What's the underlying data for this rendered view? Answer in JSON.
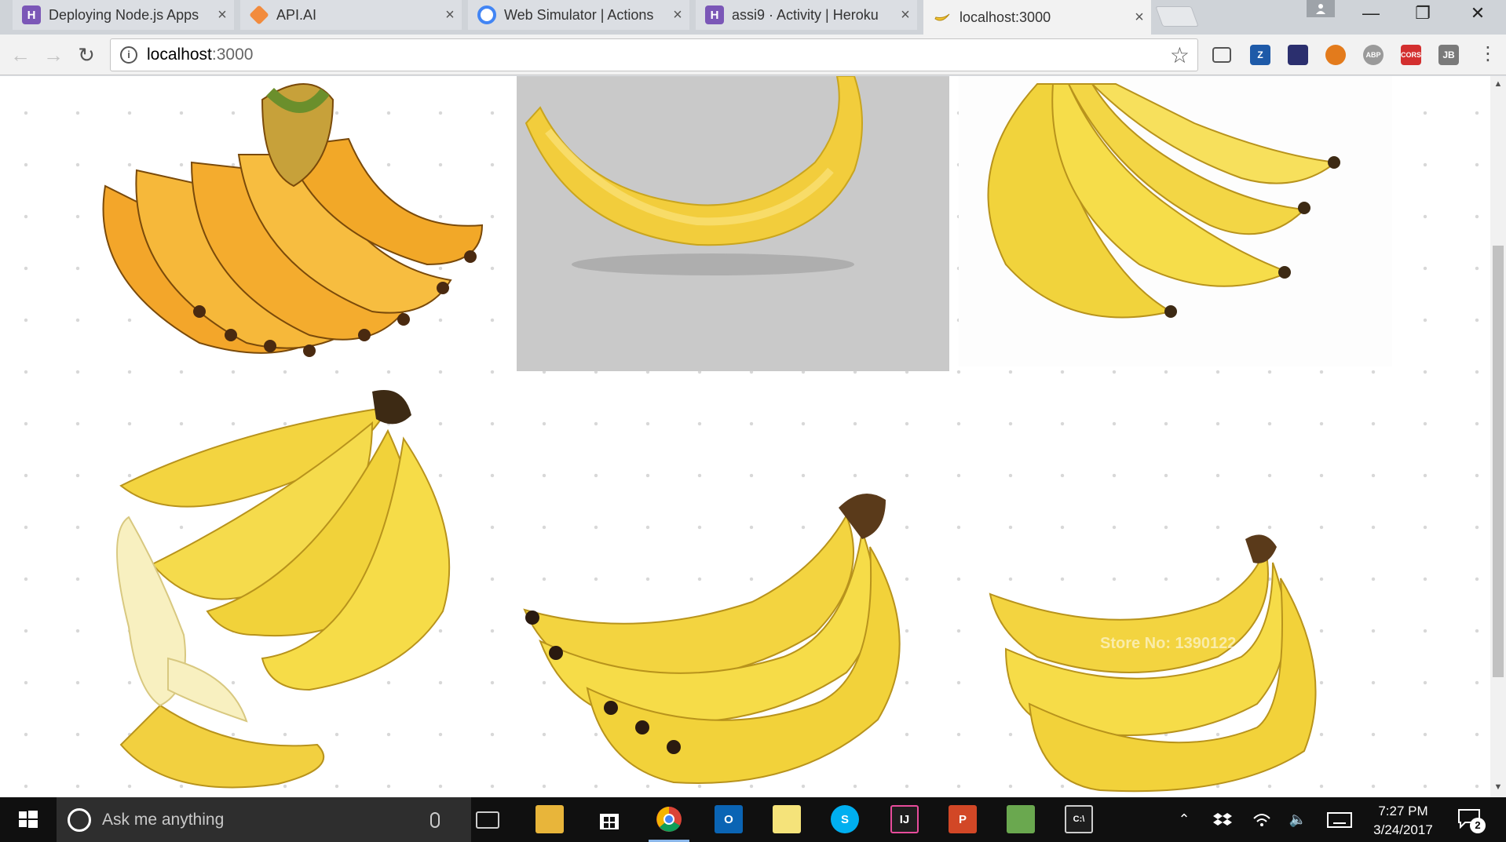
{
  "browser": {
    "tabs": [
      {
        "title": "Deploying Node.js Apps",
        "favicon_letter": "H",
        "favicon_color": "#7b57b7",
        "active": false
      },
      {
        "title": "API.AI",
        "favicon_letter": "",
        "favicon_color": "#f28b3d",
        "active": false
      },
      {
        "title": "Web Simulator | Actions",
        "favicon_letter": "",
        "favicon_color": "#4285f4",
        "active": false
      },
      {
        "title": "assi9 · Activity | Heroku",
        "favicon_letter": "H",
        "favicon_color": "#7b57b7",
        "active": false
      },
      {
        "title": "localhost:3000",
        "favicon_letter": "",
        "favicon_color": "#f2c230",
        "active": true
      }
    ],
    "close_glyph": "×",
    "window_controls": {
      "minimize": "—",
      "restore": "❐",
      "close": "✕"
    },
    "address": {
      "host": "localhost",
      "port": ":3000"
    },
    "extensions": [
      {
        "name": "cast-icon",
        "label": "",
        "color": "#f2f2f2"
      },
      {
        "name": "zotero-icon",
        "label": "Z",
        "color": "#1e5aa8"
      },
      {
        "name": "ext-dark-icon",
        "label": "",
        "color": "#2b2f6e"
      },
      {
        "name": "ext-globe-icon",
        "label": "",
        "color": "#e37b1c"
      },
      {
        "name": "adblock-plus-icon",
        "label": "ABP",
        "color": "#9a9a9a"
      },
      {
        "name": "cors-icon",
        "label": "CORS",
        "color": "#d32f2f"
      },
      {
        "name": "jetbrains-icon",
        "label": "JB",
        "color": "#7a7a7a"
      }
    ]
  },
  "page": {
    "images": [
      {
        "name": "banana-bunch-orange",
        "bg": "#ffffff"
      },
      {
        "name": "banana-single",
        "bg": "#c9c9c9"
      },
      {
        "name": "banana-bunch-yellow",
        "bg": "#ffffff"
      },
      {
        "name": "banana-bunch-peeled",
        "bg": "#ffffff"
      },
      {
        "name": "banana-bunch-five",
        "bg": "#ffffff"
      },
      {
        "name": "banana-bunch-small",
        "bg": "#ffffff"
      }
    ],
    "watermark": "Store No: 1390122"
  },
  "taskbar": {
    "search_placeholder": "Ask me anything",
    "time": "7:27 PM",
    "date": "3/24/2017",
    "notification_count": "2",
    "apps": [
      {
        "name": "task-view-icon",
        "color": "#101010"
      },
      {
        "name": "file-explorer-icon",
        "color": "#e8b53a"
      },
      {
        "name": "store-icon",
        "color": "#101010"
      },
      {
        "name": "chrome-icon",
        "color": "#101010"
      },
      {
        "name": "outlook-icon",
        "color": "#0a64b4"
      },
      {
        "name": "sticky-notes-icon",
        "color": "#f5e37a"
      },
      {
        "name": "skype-icon",
        "color": "#00aff0"
      },
      {
        "name": "intellij-icon",
        "color": "#1e1e1e"
      },
      {
        "name": "powerpoint-icon",
        "color": "#d24726"
      },
      {
        "name": "paint-icon",
        "color": "#6aa84f"
      },
      {
        "name": "cmd-icon",
        "color": "#1e1e1e"
      }
    ]
  }
}
